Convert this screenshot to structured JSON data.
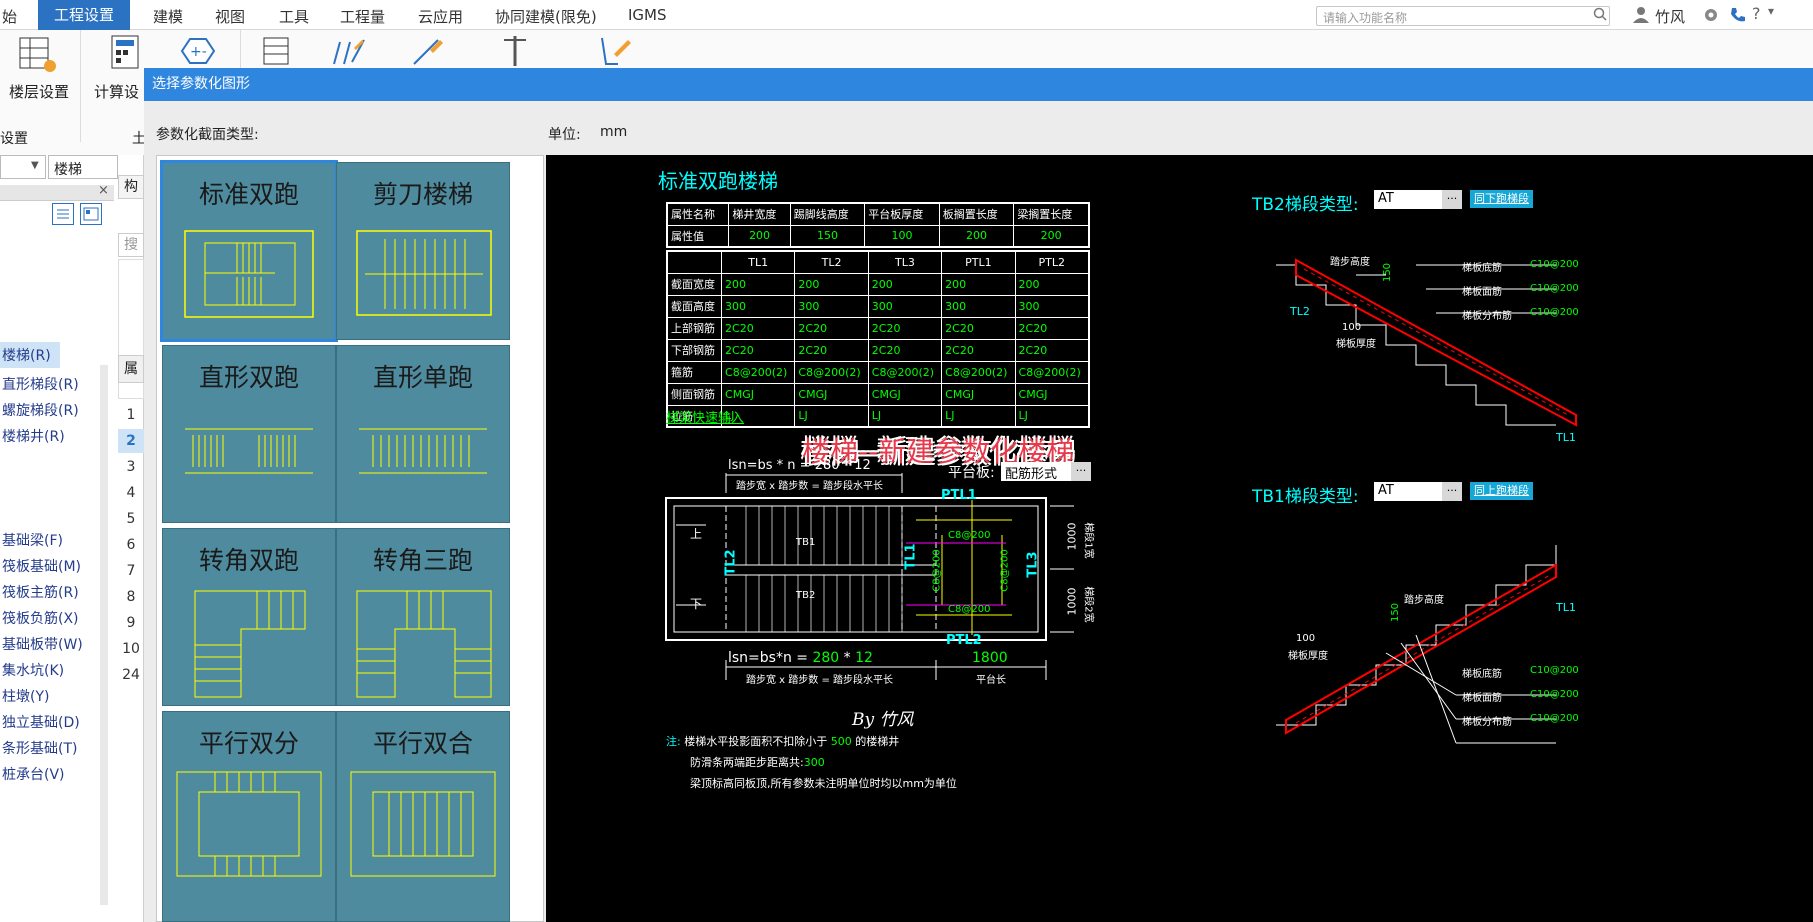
{
  "menubar": {
    "items": [
      {
        "label": "始",
        "active": false
      },
      {
        "label": "工程设置",
        "active": true
      },
      {
        "label": "建模",
        "active": false
      },
      {
        "label": "视图",
        "active": false
      },
      {
        "label": "工具",
        "active": false
      },
      {
        "label": "工程量",
        "active": false
      },
      {
        "label": "云应用",
        "active": false
      },
      {
        "label": "协同建模(限免)",
        "active": false
      },
      {
        "label": "IGMS",
        "active": false
      }
    ],
    "search_placeholder": "请输入功能名称",
    "user": "竹风"
  },
  "ribbon": {
    "floor_settings": "楼层设置",
    "calc_settings": "计算设",
    "group_label": "设置",
    "group_label2": "土"
  },
  "left_panel": {
    "combo_value": "楼梯",
    "header_short": "构",
    "search_short": "搜",
    "tree": [
      "楼梯(R)",
      "直形梯段(R)",
      "螺旋梯段(R)",
      "楼梯井(R)",
      "基础梁(F)",
      "筏板基础(M)",
      "筏板主筋(R)",
      "筏板负筋(X)",
      "基础板带(W)",
      "集水坑(K)",
      "柱墩(Y)",
      "独立基础(D)",
      "条形基础(T)",
      "桩承台(V)"
    ],
    "attr_short": "属",
    "row_numbers": [
      "1",
      "2",
      "3",
      "4",
      "5",
      "6",
      "7",
      "8",
      "9",
      "10",
      "24"
    ]
  },
  "dialog": {
    "title": "选择参数化图形",
    "type_label": "参数化截面类型:",
    "unit_label": "单位:",
    "unit_value": "mm",
    "thumbnails": [
      "标准双跑",
      "剪刀楼梯",
      "直形双跑",
      "直形单跑",
      "转角双跑",
      "转角三跑",
      "平行双分",
      "平行双合"
    ]
  },
  "drawing": {
    "title": "标准双跑楼梯",
    "attr_table": {
      "headers": [
        "属性名称",
        "梯井宽度",
        "踢脚线高度",
        "平台板厚度",
        "板搁置长度",
        "梁搁置长度"
      ],
      "values": [
        "属性值",
        "200",
        "150",
        "100",
        "200",
        "200"
      ]
    },
    "beam_table": {
      "headers": [
        "",
        "TL1",
        "TL2",
        "TL3",
        "PTL1",
        "PTL2"
      ],
      "rows": [
        [
          "截面宽度",
          "200",
          "200",
          "200",
          "200",
          "200"
        ],
        [
          "截面高度",
          "300",
          "300",
          "300",
          "300",
          "300"
        ],
        [
          "上部钢筋",
          "2C20",
          "2C20",
          "2C20",
          "2C20",
          "2C20"
        ],
        [
          "下部钢筋",
          "2C20",
          "2C20",
          "2C20",
          "2C20",
          "2C20"
        ],
        [
          "箍筋",
          "C8@200(2)",
          "C8@200(2)",
          "C8@200(2)",
          "C8@200(2)",
          "C8@200(2)"
        ],
        [
          "侧面钢筋",
          "CMGJ",
          "CMGJ",
          "CMGJ",
          "CMGJ",
          "CMGJ"
        ],
        [
          "拉筋",
          "LJ",
          "LJ",
          "LJ",
          "LJ",
          "LJ"
        ]
      ]
    },
    "quick_input_link": "梯梁快速输入",
    "watermark": "楼梯--新建参数化楼梯",
    "platform_label": "平台板:",
    "platform_value": "配筋形式",
    "dots": "···",
    "tb2_label": "TB2梯段类型:",
    "tb2_value": "AT",
    "tb2_button": "同下跑梯段",
    "tb1_label": "TB1梯段类型:",
    "tb1_value": "AT",
    "tb1_button": "同上跑梯段",
    "lsn_top": "lsn=bs * n = 280 * 12",
    "lsn_formula": "lsn=bs*n = ",
    "lsn_bs": "280",
    "lsn_star": " * ",
    "lsn_n": "12",
    "lsn_caption": "踏步宽 x 踏步数 = 踏步段水平长",
    "platform_len": "1800",
    "platform_len_caption": "平台长",
    "up_label": "上",
    "down_label": "下",
    "tb1": "TB1",
    "tb2": "TB2",
    "tl1": "TL1",
    "tl2": "TL2",
    "tl3": "TL3",
    "ptl1": "PTL1",
    "ptl2": "PTL2",
    "c8": "C8@200",
    "dim_1000a": "1000",
    "dim_1000b": "1000",
    "w1": "梯段1宽",
    "w2": "梯段2宽",
    "tread_height": "踏步高度",
    "dim_150": "150",
    "dim_100": "100",
    "slab_thickness": "梯板厚度",
    "slab_bottom": "梯板底筋",
    "slab_top": "梯板面筋",
    "slab_dist": "梯板分布筋",
    "rebar": "C10@200",
    "signature": "By 竹风",
    "note_prefix": "注:",
    "note1a": "楼梯水平投影面积不扣除小于",
    "note1b": "500",
    "note1c": "的楼梯井",
    "note2a": "防滑条两端距步距离共:",
    "note2b": "300",
    "note3": "梁顶标高同板顶,所有参数未注明单位时均以mm为单位"
  }
}
